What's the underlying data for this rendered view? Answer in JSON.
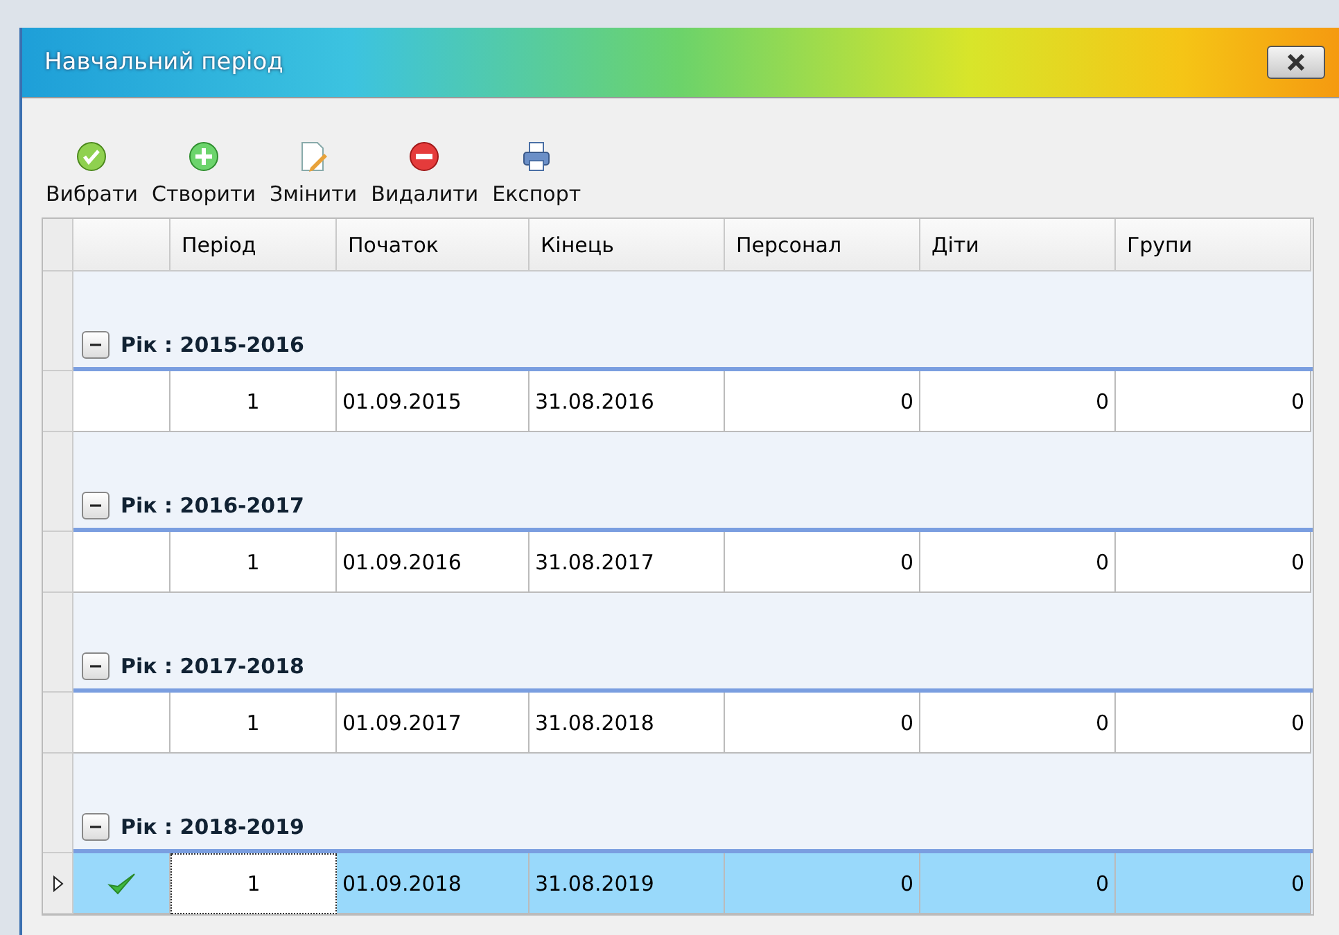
{
  "window": {
    "title": "Навчальний період"
  },
  "toolbar": [
    {
      "label": "Вибрати",
      "kind": "select"
    },
    {
      "label": "Створити",
      "kind": "create"
    },
    {
      "label": "Змінити",
      "kind": "edit"
    },
    {
      "label": "Видалити",
      "kind": "delete"
    },
    {
      "label": "Експорт",
      "kind": "export"
    }
  ],
  "table": {
    "columns": [
      "Період",
      "Початок",
      "Кінець",
      "Персонал",
      "Діти",
      "Групи"
    ],
    "groups": [
      {
        "label": "Рік : 2015-2016",
        "expanded": true,
        "rows": [
          {
            "selected": false,
            "checked": false,
            "cells": [
              "1",
              "01.09.2015",
              "31.08.2016",
              "0",
              "0",
              "0"
            ]
          }
        ]
      },
      {
        "label": "Рік : 2016-2017",
        "expanded": true,
        "rows": [
          {
            "selected": false,
            "checked": false,
            "cells": [
              "1",
              "01.09.2016",
              "31.08.2017",
              "0",
              "0",
              "0"
            ]
          }
        ]
      },
      {
        "label": "Рік : 2017-2018",
        "expanded": true,
        "rows": [
          {
            "selected": false,
            "checked": false,
            "cells": [
              "1",
              "01.09.2017",
              "31.08.2018",
              "0",
              "0",
              "0"
            ]
          }
        ]
      },
      {
        "label": "Рік : 2018-2019",
        "expanded": true,
        "rows": [
          {
            "selected": true,
            "checked": true,
            "cells": [
              "1",
              "01.09.2018",
              "31.08.2019",
              "0",
              "0",
              "0"
            ]
          }
        ]
      }
    ]
  }
}
